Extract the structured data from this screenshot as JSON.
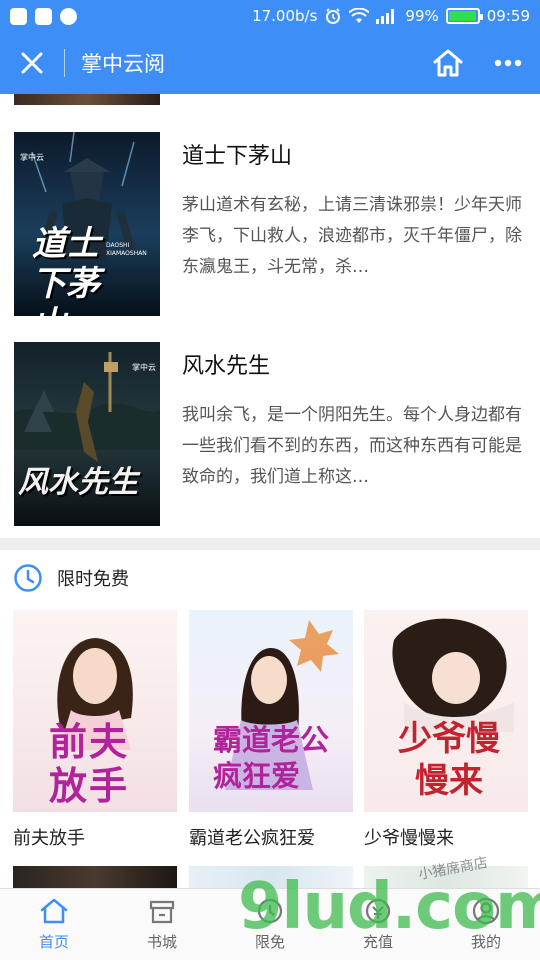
{
  "status_bar": {
    "speed": "17.00b/s",
    "battery": "99%",
    "battery_level": 0.99,
    "time": "09:59"
  },
  "title_bar": {
    "title": "掌中云阅",
    "bar_color": "#3d8ff7"
  },
  "books": [
    {
      "title": "道士下茅山",
      "description": "茅山道术有玄秘，上请三清诛邪祟！少年天师李飞，下山救人，浪迹都市，灭千年僵尸，除东瀛鬼王，斗无常，杀…",
      "cover_text": "道士下茅山",
      "cover_badge": "掌中云",
      "cover_subtitle": "DAOSHI XIAMAOSHAN"
    },
    {
      "title": "风水先生",
      "description": "我叫余飞，是一个阴阳先生。每个人身边都有一些我们看不到的东西，而这种东西有可能是致命的，我们道上称这…",
      "cover_text": "风水先生",
      "cover_badge": "掌中云"
    }
  ],
  "free_section": {
    "title": "限时免费",
    "items": [
      {
        "name": "前夫放手",
        "cover_text": "前夫放手"
      },
      {
        "name": "霸道老公疯狂爱",
        "cover_text": "霸道老公疯狂爱"
      },
      {
        "name": "少爷慢慢来",
        "cover_text": "少爷慢慢来"
      }
    ]
  },
  "bottom_nav": {
    "items": [
      {
        "label": "首页",
        "icon": "home-icon",
        "active": true
      },
      {
        "label": "书城",
        "icon": "bookstore-icon",
        "active": false
      },
      {
        "label": "限免",
        "icon": "free-icon",
        "active": false
      },
      {
        "label": "充值",
        "icon": "recharge-icon",
        "active": false
      },
      {
        "label": "我的",
        "icon": "profile-icon",
        "active": false
      }
    ]
  },
  "watermark": {
    "logo_text": "9lud.com",
    "tagline": "小猪席商店"
  },
  "colors": {
    "accent": "#3d8ff7",
    "battery_green": "#2fe04a",
    "watermark_green": "#3dbb4d",
    "watermark_orange": "#f0a020"
  }
}
